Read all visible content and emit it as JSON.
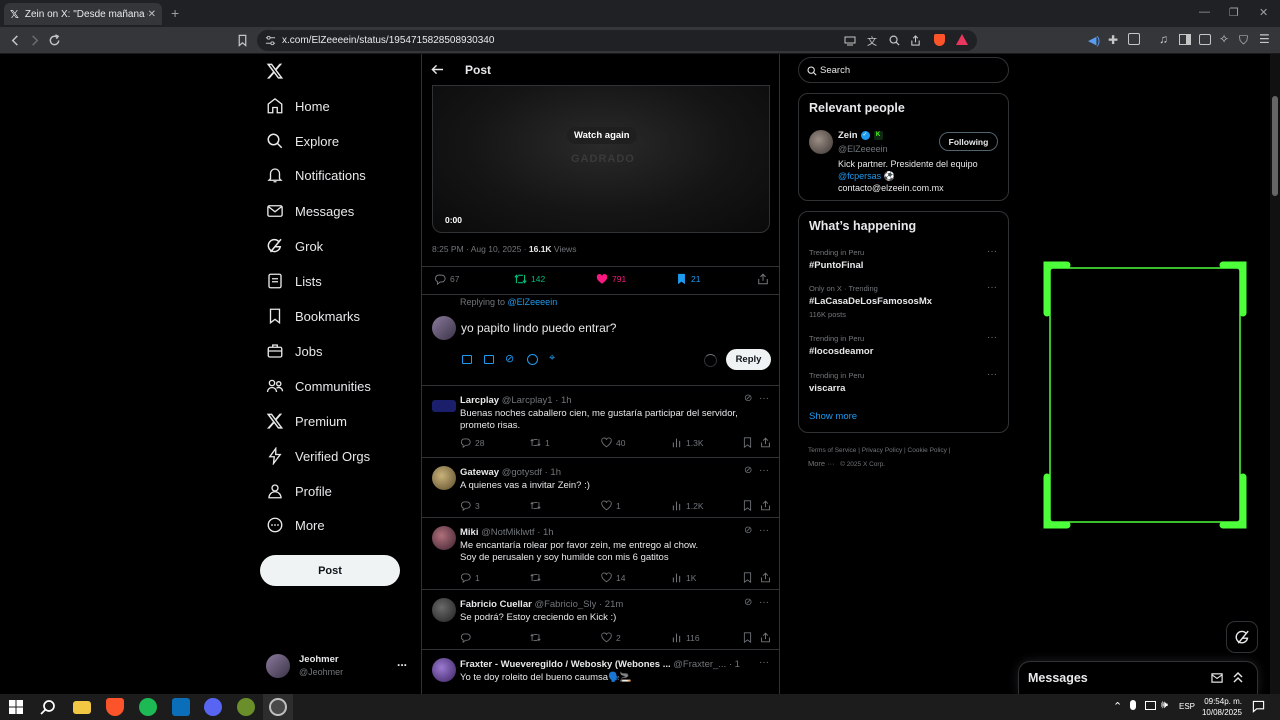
{
  "browser": {
    "tab_title": "Zein on X: \"Desde mañana empe...",
    "url": "x.com/ElZeeeein/status/1954715828508930340"
  },
  "nav": {
    "items": [
      {
        "label": "Home",
        "icon": "home-icon"
      },
      {
        "label": "Explore",
        "icon": "search-icon"
      },
      {
        "label": "Notifications",
        "icon": "bell-icon"
      },
      {
        "label": "Messages",
        "icon": "envelope-icon"
      },
      {
        "label": "Grok",
        "icon": "grok-icon"
      },
      {
        "label": "Lists",
        "icon": "list-icon"
      },
      {
        "label": "Bookmarks",
        "icon": "bookmark-icon"
      },
      {
        "label": "Jobs",
        "icon": "briefcase-icon"
      },
      {
        "label": "Communities",
        "icon": "people-icon"
      },
      {
        "label": "Premium",
        "icon": "x-logo-icon"
      },
      {
        "label": "Verified Orgs",
        "icon": "lightning-icon"
      },
      {
        "label": "Profile",
        "icon": "person-icon"
      },
      {
        "label": "More",
        "icon": "more-circle-icon"
      }
    ],
    "post_label": "Post"
  },
  "account": {
    "name": "Jeohmer",
    "handle": "@Jeohmer",
    "more": "..."
  },
  "header": {
    "title": "Post"
  },
  "video": {
    "watch_again": "Watch again",
    "time": "0:00",
    "overlay_text": "GADRADO"
  },
  "tweet_meta": {
    "time": "8:25 PM · Aug 10, 2025 · ",
    "views_num": "16.1K",
    "views_label": " Views"
  },
  "tweet_actions": {
    "replies": "67",
    "retweets": "142",
    "likes": "791",
    "bookmarks": "21"
  },
  "colors": {
    "retweet": "#00ba7c",
    "like": "#f91880",
    "bookmark": "#1d9bf0",
    "link": "#1d9bf0",
    "accent_green": "#4cff3a"
  },
  "reply_box": {
    "replying_to": "Replying to ",
    "replying_handle": "@ElZeeeein",
    "text": "yo papito lindo puedo entrar?",
    "reply_label": "Reply"
  },
  "replies": [
    {
      "name": "Larcplay",
      "handle": "@Larcplay1 · 1h",
      "text": "Buenas noches caballero cien, me gustaría participar del servidor, prometo risas.",
      "replies": "28",
      "retweets": "1",
      "likes": "40",
      "views": "1.3K"
    },
    {
      "name": "Gateway",
      "handle": "@gotysdf · 1h",
      "text": "A quienes vas a invitar Zein? :)",
      "replies": "3",
      "retweets": "",
      "likes": "1",
      "views": "1.2K"
    },
    {
      "name": "Miki",
      "handle": "@NotMiklwtf · 1h",
      "text": "Me encantaría rolear por favor zein, me entrego al chow.",
      "text2": "Soy de perusalen y soy humilde con mis 6 gatitos",
      "replies": "1",
      "retweets": "",
      "likes": "14",
      "views": "1K"
    },
    {
      "name": "Fabricio Cuellar",
      "handle": "@Fabricio_Sly · 21m",
      "text": "Se podrá? Estoy creciendo en Kick :)",
      "replies": "",
      "retweets": "",
      "likes": "2",
      "views": "116"
    },
    {
      "name": "Fraxter - Wueveregildo / Webosky (Webones ...",
      "handle": "@Fraxter_... · 16m",
      "text": "Yo te doy roleito del bueno caumsa🗣️🚬",
      "replies": "",
      "retweets": "",
      "likes": "",
      "views": ""
    }
  ],
  "search": {
    "placeholder": "Search"
  },
  "relevant": {
    "title": "Relevant people",
    "name": "Zein",
    "handle": "@ElZeeeein",
    "follow_label": "Following",
    "bio1": "Kick partner. Presidente del equipo",
    "bio_link": "@fcpersas",
    "bio_emoji": "⚽",
    "bio2": "contacto@elzeein.com.mx"
  },
  "happening": {
    "title": "What’s happening",
    "trends": [
      {
        "context": "Trending in Peru",
        "topic": "#PuntoFinal",
        "posts": ""
      },
      {
        "context": "Only on X · Trending",
        "topic": "#LaCasaDeLosFamososMx",
        "posts": "116K posts"
      },
      {
        "context": "Trending in Peru",
        "topic": "#locosdeamor",
        "posts": ""
      },
      {
        "context": "Trending in Peru",
        "topic": "viscarra",
        "posts": ""
      }
    ],
    "show_more": "Show more"
  },
  "footer": {
    "terms": "Terms of Service",
    "privacy": "Privacy Policy",
    "cookie": "Cookie Policy",
    "more": "More ···",
    "copyright": "© 2025 X Corp."
  },
  "messages_drawer": {
    "title": "Messages"
  },
  "taskbar": {
    "lang": "ESP",
    "time": "09:54p. m.",
    "date": "10/08/2025"
  }
}
